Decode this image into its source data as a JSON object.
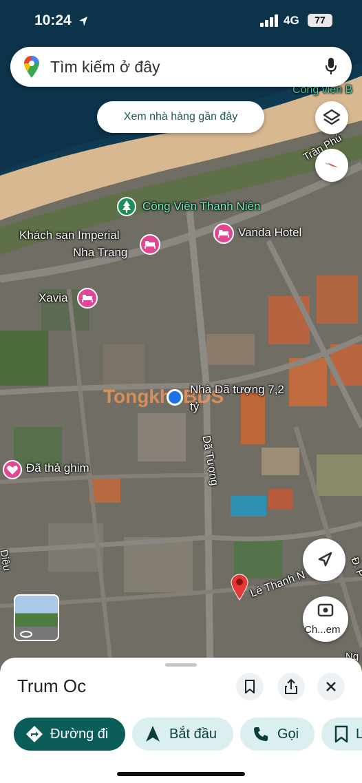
{
  "status_bar": {
    "time": "10:24",
    "network": "4G",
    "battery": "77"
  },
  "search": {
    "placeholder": "Tìm kiếm ở đây"
  },
  "suggest_chip": {
    "label": "Xem nhà hàng gần đây"
  },
  "map": {
    "labels": {
      "park_top": "Cong viên B",
      "street_tran_phu": "Trần Phú",
      "park_thanh_nien": "Công Viên Thanh Niên",
      "hotel_vanda": "Vanda Hotel",
      "hotel_imperial_1": "Khách sạn Imperial",
      "hotel_imperial_2": "Nha Trang",
      "hotel_xavia": "Xavia",
      "listing_1": "Nhà Dã tượng 7,2",
      "listing_2": "tỷ",
      "street_da_tuong": "Dã Tượng",
      "pinned": "Đã thả ghim",
      "street_le_thanh": "Lê Thanh N",
      "street_dieu": "Diệu",
      "street_right": "Đ. P",
      "street_ngo": "Ng",
      "watermark": "TongkhoBDS"
    },
    "streetview_label": "Ch...em"
  },
  "sheet": {
    "title": "Trum Oc",
    "actions": [
      {
        "label": "Đường đi",
        "icon": "directions-icon"
      },
      {
        "label": "Bắt đầu",
        "icon": "navigation-arrow-icon"
      },
      {
        "label": "Gọi",
        "icon": "phone-icon"
      },
      {
        "label": "L",
        "icon": "bookmark-icon"
      }
    ]
  },
  "colors": {
    "accent": "#0b5d5a",
    "chip_bg": "#dbeef0",
    "pin_red": "#e53935",
    "hotel_pink": "#e44693"
  }
}
